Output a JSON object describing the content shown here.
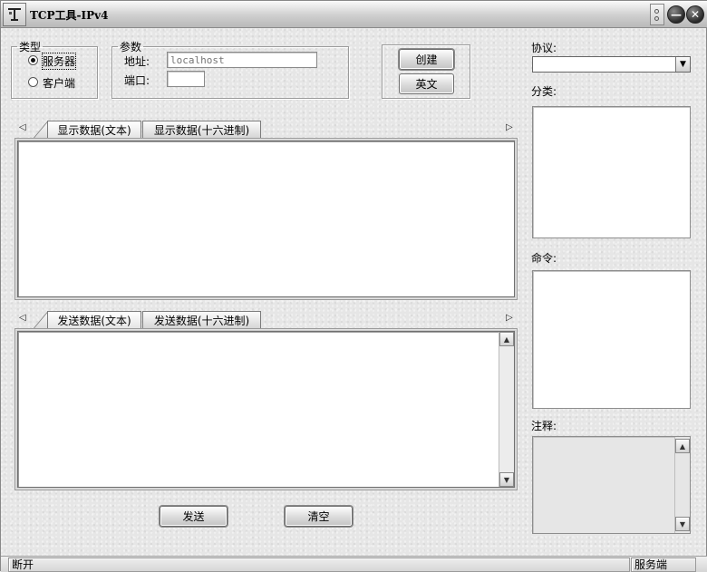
{
  "window": {
    "title": "TCP工具-IPv4",
    "icon": "tool-icon"
  },
  "titlebar_buttons": {
    "minimize_glyph": "—",
    "close_glyph": "✕"
  },
  "type_group": {
    "legend": "类型",
    "options": [
      {
        "label": "服务器",
        "selected": true
      },
      {
        "label": "客户端",
        "selected": false
      }
    ]
  },
  "params_group": {
    "legend": "参数",
    "address_label": "地址:",
    "address_placeholder": "localhost",
    "address_value": "",
    "port_label": "端口:",
    "port_value": ""
  },
  "actions": {
    "create": "创建",
    "english": "英文"
  },
  "display_tabs": {
    "tabs": [
      "显示数据(文本)",
      "显示数据(十六进制)"
    ],
    "active": 0
  },
  "send_tabs": {
    "tabs": [
      "发送数据(文本)",
      "发送数据(十六进制)"
    ],
    "active": 0
  },
  "buttons": {
    "send": "发送",
    "clear": "清空"
  },
  "right_panel": {
    "protocol_label": "协议:",
    "protocol_value": "",
    "category_label": "分类:",
    "command_label": "命令:",
    "comment_label": "注释:"
  },
  "status": {
    "left": "断开",
    "right": "服务端"
  },
  "arrows": {
    "left": "◁",
    "right": "▷",
    "up": "▲",
    "down": "▼"
  }
}
